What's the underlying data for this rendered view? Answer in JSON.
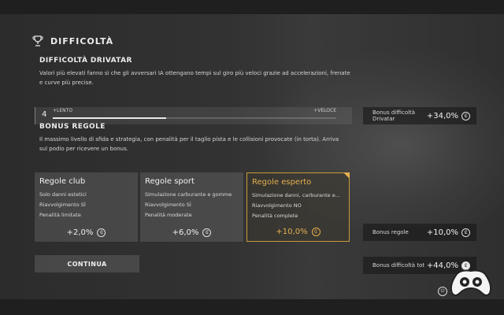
{
  "header": {
    "title": "DIFFICOLTÀ"
  },
  "drivatar": {
    "title": "DIFFICOLTÀ DRIVATAR",
    "description": "Valori più elevati fanno sì che gli avversari IA ottengano tempi sul giro più veloci grazie ad accelerazioni, frenate e curve più precise.",
    "slider": {
      "value": "4",
      "min_label": "LENTO",
      "max_label": "VELOCE",
      "level": 0.4
    },
    "bonus_label": "Bonus difficoltà Drivatar",
    "bonus_value": "+34,0%"
  },
  "rules": {
    "title": "BONUS REGOLE",
    "description": "Il massimo livello di sfida e strategia, con penalità per il taglio pista e le collisioni provocate (in torta). Arriva sul podio per ricevere un bonus.",
    "cards": [
      {
        "title": "Regole club",
        "lines": [
          "Solo danni estetici",
          "Riavvolgimento SÌ",
          "Penalità limitate"
        ],
        "bonus": "+2,0%"
      },
      {
        "title": "Regole sport",
        "lines": [
          "Simulazione carburante e gomme",
          "Riavvolgimento SÌ",
          "Penalità moderate"
        ],
        "bonus": "+6,0%"
      },
      {
        "title": "Regole esperto",
        "lines": [
          "Simulazione danni, carburante e...",
          "Riavvolgimento NO",
          "Penalità complete"
        ],
        "bonus": "+10,0%",
        "selected": true
      }
    ],
    "bonus_label": "Bonus regole",
    "bonus_value": "+10,0%"
  },
  "total": {
    "label": "Bonus difficoltà tot",
    "value": "+44,0%"
  },
  "continue_label": "CONTINUA",
  "footer": {
    "hint": "S"
  },
  "icons": {
    "header": "trophy-icon",
    "currency": "credit-coin-icon",
    "footer": "controller-button-icon",
    "watermark": "gamepad-icon"
  },
  "colors": {
    "accent": "#e5b04e",
    "background": "#2c2c2c"
  }
}
